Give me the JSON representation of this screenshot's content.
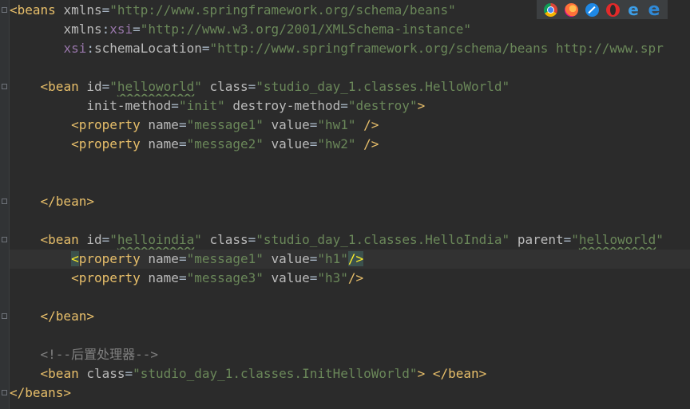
{
  "code": {
    "l1": {
      "lt": "<",
      "tag": "beans",
      "a1": " xmlns",
      "eq": "=",
      "v1": "\"http://www.springframework.org/schema/beans\""
    },
    "l2": {
      "indent": "       ",
      "a1": "xmlns",
      "colon": ":",
      "ns": "xsi",
      "eq": "=",
      "v1": "\"http://www.w3.org/2001/XMLSchema-instance\""
    },
    "l3": {
      "indent": "       ",
      "ns": "xsi",
      "colon": ":",
      "a1": "schemaLocation",
      "eq": "=",
      "v1": "\"http://www.springframework.org/schema/beans http://www.spr"
    },
    "l5": {
      "indent": "    ",
      "lt": "<",
      "tag": "bean",
      "a1": " id",
      "eq1": "=",
      "q1": "\"",
      "v1": "helloworld",
      "q2": "\"",
      "a2": " class",
      "eq2": "=",
      "v2": "\"studio_day_1.classes.HelloWorld\""
    },
    "l6": {
      "indent": "          ",
      "a1": "init-method",
      "eq1": "=",
      "v1": "\"init\"",
      "a2": " destroy-method",
      "eq2": "=",
      "v2": "\"destroy\"",
      "gt": ">"
    },
    "l7": {
      "indent": "        ",
      "lt": "<",
      "tag": "property",
      "a1": " name",
      "eq1": "=",
      "v1": "\"message1\"",
      "a2": " value",
      "eq2": "=",
      "v2": "\"hw1\"",
      "end": " />"
    },
    "l8": {
      "indent": "        ",
      "lt": "<",
      "tag": "property",
      "a1": " name",
      "eq1": "=",
      "v1": "\"message2\"",
      "a2": " value",
      "eq2": "=",
      "v2": "\"hw2\"",
      "end": " />"
    },
    "l11": {
      "indent": "    ",
      "text": "</bean>"
    },
    "l13": {
      "indent": "    ",
      "lt": "<",
      "tag": "bean",
      "a1": " id",
      "eq1": "=",
      "q1": "\"",
      "v1": "helloindia",
      "q2": "\"",
      "a2": " class",
      "eq2": "=",
      "v2": "\"studio_day_1.classes.HelloIndia\"",
      "a3": " parent",
      "eq3": "=",
      "q3": "\"",
      "v3": "helloworld",
      "q4": "\""
    },
    "l14": {
      "indent": "        ",
      "lt": "<",
      "tag": "property",
      "a1": " name",
      "eq1": "=",
      "v1": "\"message1\"",
      "a2": " value",
      "eq2": "=",
      "v2": "\"h1\"",
      "end": "/>"
    },
    "l15": {
      "indent": "        ",
      "lt": "<",
      "tag": "property",
      "a1": " name",
      "eq1": "=",
      "v1": "\"message3\"",
      "a2": " value",
      "eq2": "=",
      "v2": "\"h3\"",
      "end": "/>"
    },
    "l17": {
      "indent": "    ",
      "text": "</bean>"
    },
    "l19": {
      "indent": "    ",
      "text": "<!--后置处理器-->"
    },
    "l20": {
      "indent": "    ",
      "lt": "<",
      "tag": "bean",
      "a1": " class",
      "eq": "=",
      "v1": "\"studio_day_1.classes.InitHelloWorld\"",
      "gt": ">",
      "close": " </bean>"
    },
    "l21": {
      "text": "</beans>"
    }
  },
  "browsers": {
    "chrome": "chrome-icon",
    "firefox": "firefox-icon",
    "safari": "safari-icon",
    "opera": "opera-icon",
    "ie": "internet-explorer-icon",
    "edge": "edge-icon",
    "ie_glyph": "e",
    "edge_glyph": "e"
  },
  "colors": {
    "background": "#2b2b2b",
    "tag": "#e8bf6a",
    "attribute": "#bababa",
    "namespace": "#9876aa",
    "string": "#6a8759",
    "comment": "#808080",
    "text": "#a9b7c6"
  }
}
